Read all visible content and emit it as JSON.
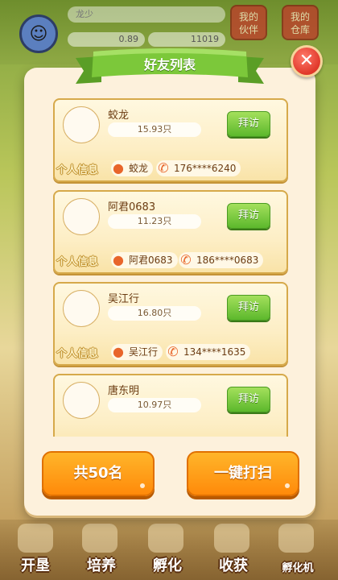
{
  "hud": {
    "player_name": "龙少",
    "stat_1": "0.89",
    "stat_2": "11019",
    "btn_partner": "我的\n伙伴",
    "btn_warehouse": "我的\n仓库"
  },
  "bottom_nav": [
    "开垦",
    "培养",
    "孵化",
    "收获",
    "孵化机"
  ],
  "modal": {
    "title": "好友列表",
    "close_icon": "close-x",
    "info_label": "个人信息",
    "visit_label": "拜访",
    "friends": [
      {
        "name": "蛟龙",
        "amount": "15.93只",
        "user": "蛟龙",
        "phone": "176****6240"
      },
      {
        "name": "阿君0683",
        "amount": "11.23只",
        "user": "阿君0683",
        "phone": "186****0683"
      },
      {
        "name": "吴江行",
        "amount": "16.80只",
        "user": "吴江行",
        "phone": "134****1635"
      },
      {
        "name": "唐东明",
        "amount": "10.97只",
        "user": "",
        "phone": ""
      }
    ],
    "total_label": "共50名",
    "sweep_label": "一键打扫"
  },
  "colors": {
    "accent_orange": "#ff8a0a",
    "visit_green": "#5cb82c",
    "close_red": "#e0382a",
    "ribbon_green": "#7cc83a"
  }
}
